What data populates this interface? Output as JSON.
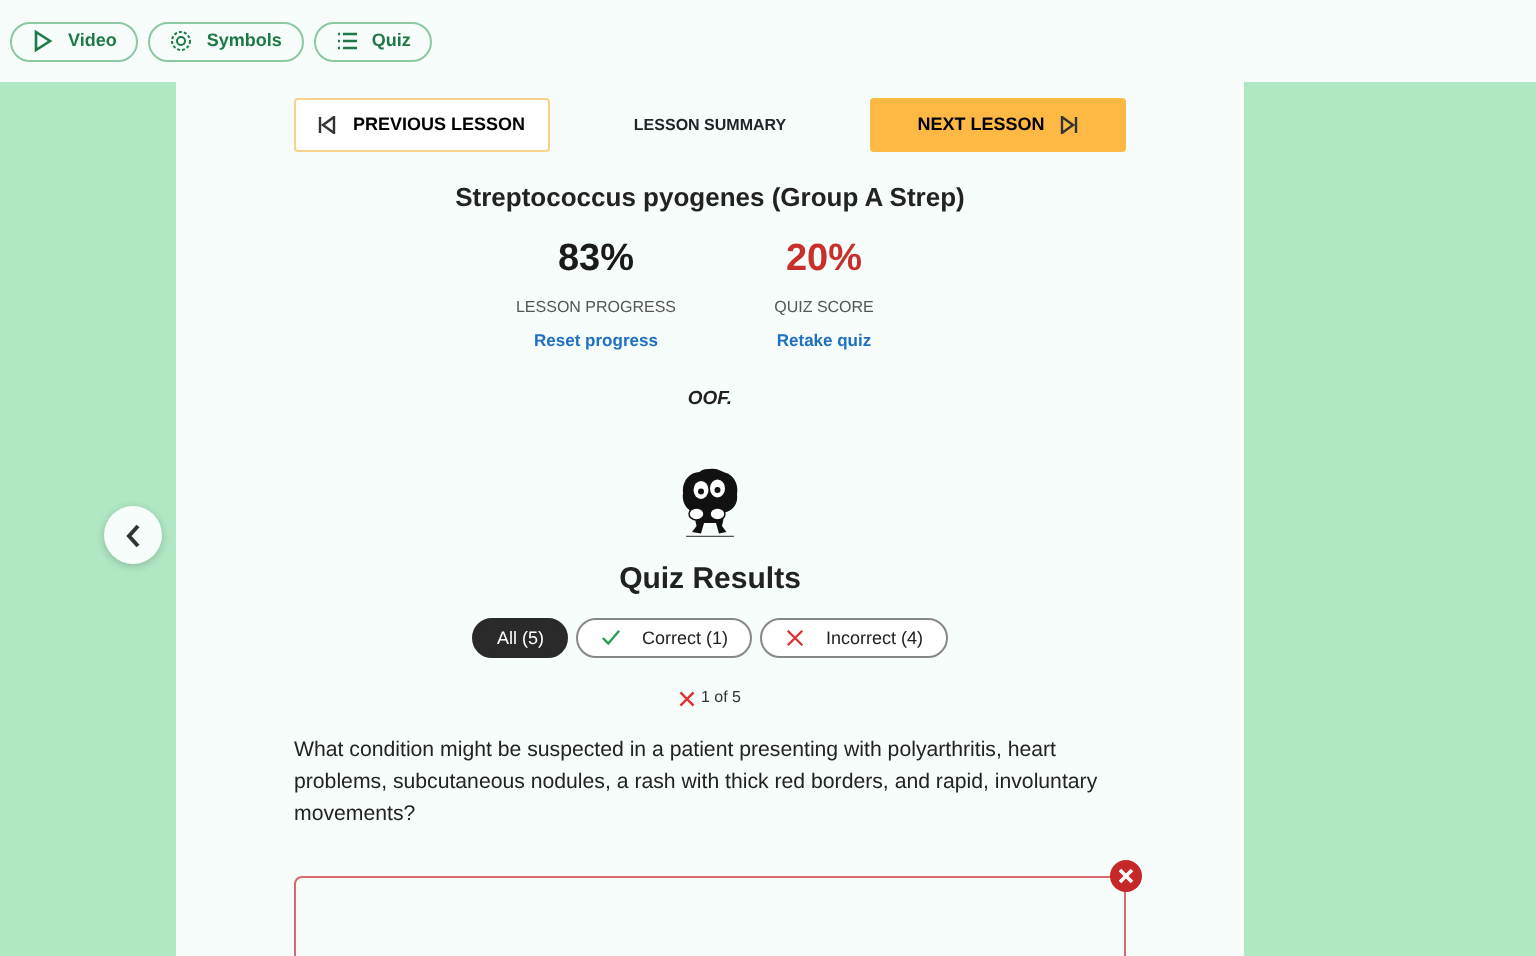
{
  "top_tabs": [
    {
      "kind": "video",
      "label": "Video"
    },
    {
      "kind": "symbols",
      "label": "Symbols"
    },
    {
      "kind": "quiz",
      "label": "Quiz"
    }
  ],
  "nav": {
    "previous": "PREVIOUS LESSON",
    "summary": "LESSON SUMMARY",
    "next": "NEXT LESSON"
  },
  "title": "Streptococcus pyogenes (Group A Strep)",
  "stats": [
    {
      "value": "83%",
      "label": "LESSON PROGRESS",
      "link": "Reset progress",
      "color": "#1a1a1a"
    },
    {
      "value": "20%",
      "label": "QUIZ SCORE",
      "link": "Retake quiz",
      "color": "#c9302c"
    }
  ],
  "reaction": "OOF.",
  "results": {
    "heading": "Quiz Results",
    "filters": [
      {
        "kind": "all",
        "label": "All (5)",
        "selected": true
      },
      {
        "kind": "correct",
        "label": "Correct (1)",
        "selected": false
      },
      {
        "kind": "incorrect",
        "label": "Incorrect (4)",
        "selected": false
      }
    ],
    "question": {
      "correct": false,
      "counter": "1 of 5",
      "text": "What condition might be suspected in a patient presenting with polyarthritis, heart problems, subcutaneous nodules, a rash with thick red borders, and rapid, involuntary movements?",
      "answer": {
        "correct": false
      }
    }
  }
}
